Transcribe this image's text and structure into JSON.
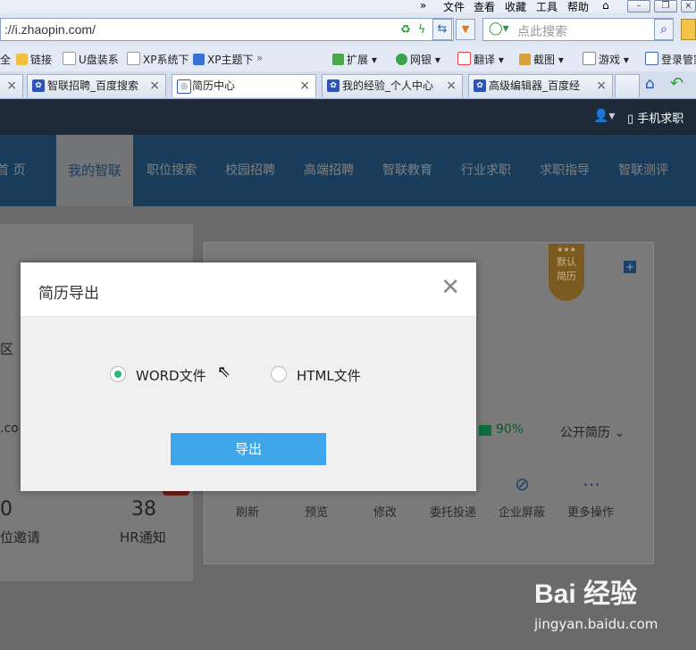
{
  "browser": {
    "menu": [
      "文件",
      "查看",
      "收藏",
      "工具",
      "帮助"
    ],
    "url": "http://i.zhaopin.com/",
    "url_visible": "://i.zhaopin.com/",
    "search_placeholder": "点此搜索",
    "bookmarks": [
      "全",
      "链接",
      "U盘装系",
      "XP系统下",
      "XP主题下",
      "扩展",
      "网银",
      "翻译",
      "截图",
      "游戏",
      "登录管家"
    ],
    "tabs": [
      {
        "label": "智联招聘_百度搜索",
        "active": false
      },
      {
        "label": "简历中心",
        "active": true
      },
      {
        "label": "我的经验_个人中心",
        "active": false
      },
      {
        "label": "高级编辑器_百度经",
        "active": false
      }
    ]
  },
  "site": {
    "phone_link": "手机求职",
    "nav": [
      "首 页",
      "我的智联",
      "职位搜索",
      "校园招聘",
      "高端招聘",
      "智联教育",
      "行业求职",
      "求职指导",
      "智联测评"
    ],
    "nav_active_index": 1,
    "ribbon": "默认简历",
    "left_cut_1": "区",
    "left_cut_2": ".co",
    "progress_pct": "90%",
    "public_resume": "公开简历",
    "actions": [
      "刷新",
      "预览",
      "修改",
      "委托投递",
      "企业屏蔽",
      "更多操作"
    ],
    "stats": [
      {
        "value": "0",
        "label": "位邀请"
      },
      {
        "value": "38",
        "label": "HR通知"
      }
    ]
  },
  "modal": {
    "title": "简历导出",
    "close_icon": "close-icon",
    "options": [
      {
        "label": "WORD文件",
        "selected": true
      },
      {
        "label": "HTML文件",
        "selected": false
      }
    ],
    "export_label": "导出"
  },
  "watermark": {
    "logo": "Bai 经验",
    "url": "jingyan.baidu.com"
  },
  "colors": {
    "nav_bg": "#2f6ea5",
    "radio_selected": "#2bb673",
    "export_button": "#3fa6ec"
  }
}
